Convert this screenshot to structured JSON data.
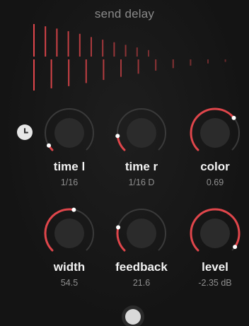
{
  "title": "send delay",
  "colors": {
    "accent": "#e0464b",
    "track": "#3a3a3a",
    "knob": "#2b2b2b",
    "dot": "#ffffff"
  },
  "taps_top": [
    1.0,
    0.93,
    0.86,
    0.78,
    0.7,
    0.6,
    0.52,
    0.44,
    0.36,
    0.28,
    0.2
  ],
  "taps_bottom": [
    1.0,
    0.93,
    0.86,
    0.76,
    0.66,
    0.56,
    0.46,
    0.36,
    0.28,
    0.2,
    0.13,
    0.08
  ],
  "knobs": [
    {
      "id": "time-l",
      "label": "time l",
      "value": "1/16",
      "level": 0.05
    },
    {
      "id": "time-r",
      "label": "time r",
      "value": "1/16 D",
      "level": 0.14
    },
    {
      "id": "color",
      "label": "color",
      "value": "0.69",
      "level": 0.69
    },
    {
      "id": "width",
      "label": "width",
      "value": "54.5",
      "level": 0.54
    },
    {
      "id": "feedback",
      "label": "feedback",
      "value": "21.6",
      "level": 0.22
    },
    {
      "id": "level",
      "label": "level",
      "value": "-2.35 dB",
      "level": 0.96
    }
  ]
}
